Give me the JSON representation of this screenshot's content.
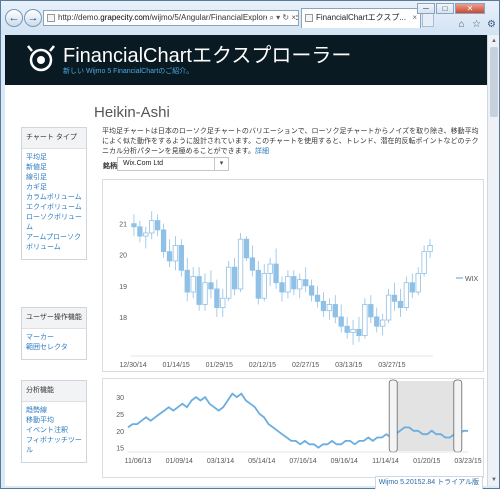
{
  "browser": {
    "url_prefix": "http://demo.",
    "url_host": "grapecity.com",
    "url_rest": "/wijmo/5/Angular/FinancialExplorer/FinancialC",
    "url_tools": "⌕ ▾ ↻ ×",
    "tab_title": "FinancialChartエクスプ...",
    "tab_close": "×",
    "back": "←",
    "forward": "→",
    "minimize": "─",
    "maximize": "□",
    "close": "✕"
  },
  "header": {
    "title_latin": "FinancialChart",
    "title_jp": "エクスプローラー",
    "subtitle": "新しい Wijmo 5 FinancialChartのご紹介。"
  },
  "sidebar": [
    {
      "heading": "チャート タイプ",
      "items": [
        "平均足",
        "新値足",
        "線引足",
        "カギ足",
        "カラムボリューム",
        "エクイボリューム",
        "ローソクボリューム",
        "アームプローソクボリューム"
      ]
    },
    {
      "heading": "ユーザー操作機能",
      "items": [
        "マーカー",
        "範囲セレクタ"
      ]
    },
    {
      "heading": "分析機能",
      "items": [
        "趋勢線",
        "移動平均",
        "イベント注釈",
        "フィボナッチツール"
      ]
    }
  ],
  "main": {
    "title": "Heikin-Ashi",
    "description": "平均足チャートは日本のローソク足チャートのバリエーションで、ローソク足チャートからノイズを取り除き、移動平均によく似た動作をするように設計されています。このチャートを使用すると、トレンド、潜在的反転ポイントなどのテクニカル分析パターンを見極めることができます。",
    "detail_link": "詳細",
    "select_label": "銘柄",
    "select_value": "Wix.Com Ltd"
  },
  "status_text": "Wijmo 5.20152.84 トライアル版",
  "colors": {
    "accent": "#4fa8e0",
    "series": "#8fc0e6",
    "nav_series": "#6aaee0",
    "header_bg": "#0a1a22"
  },
  "chart_data": [
    {
      "type": "heikin-ashi",
      "legend": [
        "WIX"
      ],
      "legend_position": "right",
      "x_ticks": [
        "12/30/14",
        "01/14/15",
        "01/29/15",
        "02/12/15",
        "02/27/15",
        "03/13/15",
        "03/27/15"
      ],
      "y_ticks": [
        18,
        19,
        20,
        21
      ],
      "ylim": [
        17.0,
        21.6
      ],
      "grid": false,
      "candles": [
        [
          21.0,
          21.3,
          20.6,
          20.9
        ],
        [
          20.9,
          21.1,
          20.4,
          20.6
        ],
        [
          20.6,
          20.9,
          20.2,
          20.7
        ],
        [
          20.7,
          21.4,
          20.5,
          21.1
        ],
        [
          21.1,
          21.3,
          20.6,
          20.8
        ],
        [
          20.8,
          21.0,
          19.9,
          20.1
        ],
        [
          20.1,
          20.5,
          19.6,
          19.8
        ],
        [
          19.8,
          20.6,
          19.5,
          20.3
        ],
        [
          20.3,
          20.5,
          19.3,
          19.5
        ],
        [
          19.5,
          19.9,
          18.5,
          18.8
        ],
        [
          18.8,
          19.6,
          18.6,
          19.3
        ],
        [
          19.3,
          19.6,
          18.2,
          18.4
        ],
        [
          18.4,
          19.4,
          18.2,
          19.1
        ],
        [
          19.1,
          19.5,
          18.6,
          18.9
        ],
        [
          18.9,
          19.2,
          18.0,
          18.3
        ],
        [
          18.3,
          18.9,
          18.0,
          18.6
        ],
        [
          18.6,
          19.8,
          18.5,
          19.6
        ],
        [
          19.6,
          19.9,
          18.7,
          18.9
        ],
        [
          18.9,
          20.7,
          18.8,
          20.5
        ],
        [
          20.5,
          20.6,
          19.8,
          19.9
        ],
        [
          19.9,
          20.3,
          19.3,
          19.5
        ],
        [
          19.5,
          19.8,
          18.4,
          18.6
        ],
        [
          18.6,
          19.7,
          18.5,
          19.4
        ],
        [
          19.4,
          19.9,
          19.0,
          19.7
        ],
        [
          19.7,
          20.2,
          18.9,
          19.1
        ],
        [
          19.1,
          19.3,
          18.5,
          18.8
        ],
        [
          18.8,
          19.5,
          18.6,
          19.3
        ],
        [
          19.3,
          19.5,
          18.7,
          18.9
        ],
        [
          18.9,
          19.4,
          18.6,
          19.2
        ],
        [
          19.2,
          19.6,
          18.8,
          19.0
        ],
        [
          19.0,
          19.2,
          18.5,
          18.7
        ],
        [
          18.7,
          19.0,
          18.3,
          18.5
        ],
        [
          18.5,
          18.8,
          18.0,
          18.2
        ],
        [
          18.2,
          18.6,
          17.9,
          18.4
        ],
        [
          18.4,
          18.7,
          17.8,
          18.0
        ],
        [
          18.0,
          18.4,
          17.5,
          17.7
        ],
        [
          17.7,
          18.0,
          17.3,
          17.5
        ],
        [
          17.5,
          17.9,
          17.1,
          17.6
        ],
        [
          17.6,
          18.0,
          17.2,
          17.4
        ],
        [
          17.4,
          18.6,
          17.3,
          18.4
        ],
        [
          18.4,
          18.7,
          17.8,
          18.0
        ],
        [
          18.0,
          18.3,
          17.5,
          17.7
        ],
        [
          17.7,
          18.1,
          17.4,
          17.9
        ],
        [
          17.9,
          18.9,
          17.8,
          18.7
        ],
        [
          18.7,
          19.1,
          18.2,
          18.5
        ],
        [
          18.5,
          18.9,
          18.0,
          18.3
        ],
        [
          18.3,
          19.3,
          18.2,
          19.1
        ],
        [
          19.1,
          19.4,
          18.6,
          18.8
        ],
        [
          18.8,
          19.6,
          18.7,
          19.4
        ],
        [
          19.4,
          20.3,
          19.3,
          20.1
        ],
        [
          20.1,
          20.5,
          19.9,
          20.3
        ]
      ]
    },
    {
      "type": "line",
      "role": "range-selector",
      "x_ticks": [
        "11/06/13",
        "01/09/14",
        "03/13/14",
        "05/14/14",
        "07/16/14",
        "09/16/14",
        "11/14/14",
        "01/20/15",
        "03/23/15"
      ],
      "y_ticks": [
        15,
        20,
        25,
        30
      ],
      "ylim": [
        14,
        33
      ],
      "values": [
        21,
        22,
        22,
        23,
        24,
        23,
        24,
        25,
        26,
        27,
        26,
        27,
        28,
        27,
        29,
        30,
        29,
        30,
        28,
        27,
        26,
        27,
        29,
        31,
        30,
        31,
        29,
        28,
        27,
        25,
        24,
        22,
        21,
        20,
        19,
        18,
        17,
        17,
        16,
        17,
        16,
        16,
        15,
        16,
        16,
        17,
        16,
        16,
        17,
        17,
        16,
        17,
        17,
        18,
        17,
        18,
        18,
        19,
        18,
        19,
        20,
        21,
        21,
        20,
        20,
        19,
        19,
        20,
        19,
        19,
        18,
        18,
        19,
        19,
        20,
        20
      ],
      "selection": [
        0.78,
        0.97
      ]
    }
  ]
}
